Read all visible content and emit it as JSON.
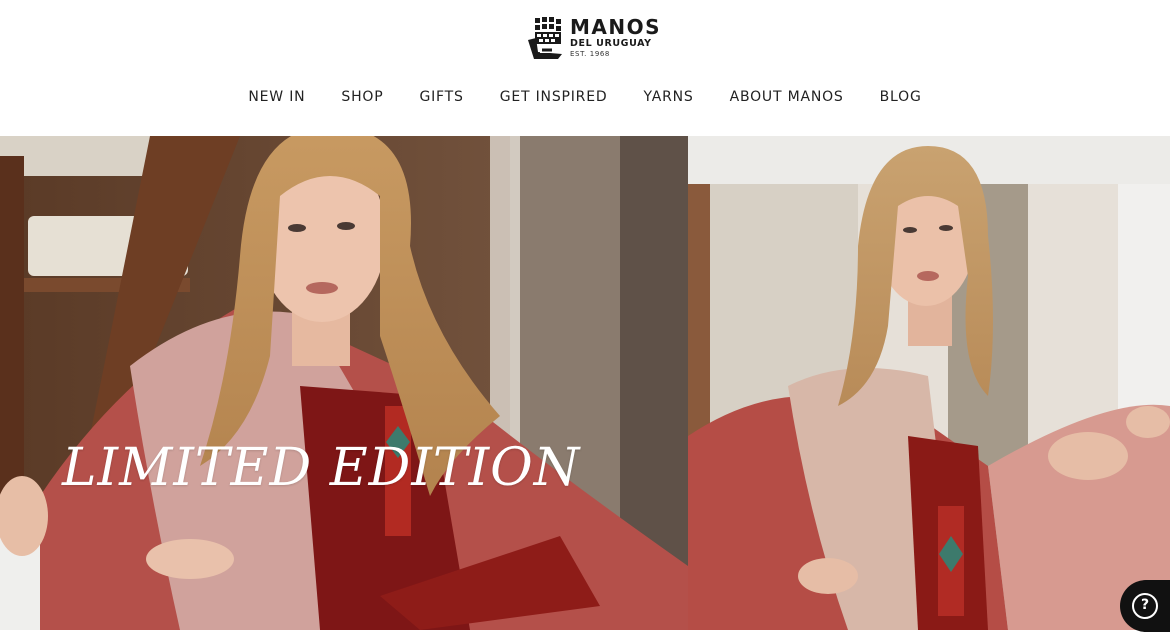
{
  "brand": {
    "name": "MANOS",
    "subtitle": "DEL URUGUAY",
    "established": "EST. 1968"
  },
  "nav": {
    "items": [
      {
        "label": "NEW IN"
      },
      {
        "label": "SHOP"
      },
      {
        "label": "GIFTS"
      },
      {
        "label": "GET INSPIRED"
      },
      {
        "label": "YARNS"
      },
      {
        "label": "ABOUT MANOS"
      },
      {
        "label": "BLOG"
      }
    ]
  },
  "hero": {
    "headline": "LIMITED EDITION"
  },
  "help": {
    "icon": "question-mark",
    "glyph": "?"
  },
  "colors": {
    "text": "#222222",
    "background": "#ffffff",
    "help_button": "#111111"
  }
}
